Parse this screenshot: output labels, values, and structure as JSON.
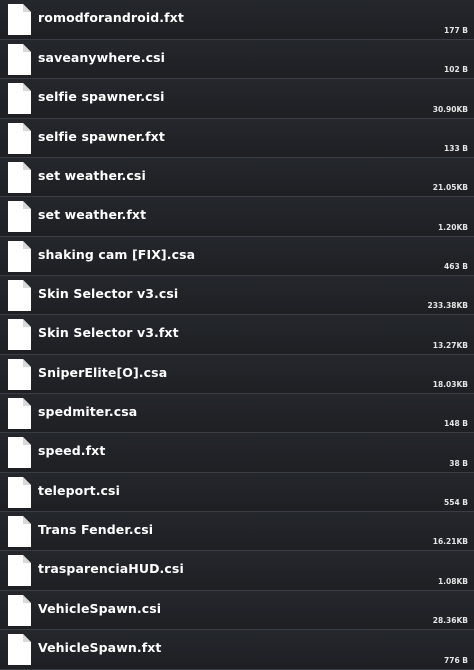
{
  "files": [
    {
      "name": "romodforandroid.fxt",
      "size": "177 B",
      "icon": "file-icon"
    },
    {
      "name": "saveanywhere.csi",
      "size": "102 B",
      "icon": "file-icon"
    },
    {
      "name": "selfie spawner.csi",
      "size": "30.90KB",
      "icon": "file-icon"
    },
    {
      "name": "selfie spawner.fxt",
      "size": "133 B",
      "icon": "file-icon"
    },
    {
      "name": "set weather.csi",
      "size": "21.05KB",
      "icon": "file-icon"
    },
    {
      "name": "set weather.fxt",
      "size": "1.20KB",
      "icon": "file-icon"
    },
    {
      "name": "shaking cam [FIX].csa",
      "size": "463 B",
      "icon": "file-icon"
    },
    {
      "name": "Skin Selector v3.csi",
      "size": "233.38KB",
      "icon": "file-icon"
    },
    {
      "name": "Skin Selector v3.fxt",
      "size": "13.27KB",
      "icon": "file-icon"
    },
    {
      "name": "SniperElite[O].csa",
      "size": "18.03KB",
      "icon": "file-icon"
    },
    {
      "name": "spedmiter.csa",
      "size": "148 B",
      "icon": "file-icon"
    },
    {
      "name": "speed.fxt",
      "size": "38 B",
      "icon": "file-icon"
    },
    {
      "name": "teleport.csi",
      "size": "554 B",
      "icon": "file-icon"
    },
    {
      "name": "Trans Fender.csi",
      "size": "16.21KB",
      "icon": "file-icon"
    },
    {
      "name": "trasparenciaHUD.csi",
      "size": "1.08KB",
      "icon": "file-icon"
    },
    {
      "name": "VehicleSpawn.csi",
      "size": "28.36KB",
      "icon": "file-icon"
    },
    {
      "name": "VehicleSpawn.fxt",
      "size": "776 B",
      "icon": "file-icon"
    }
  ]
}
